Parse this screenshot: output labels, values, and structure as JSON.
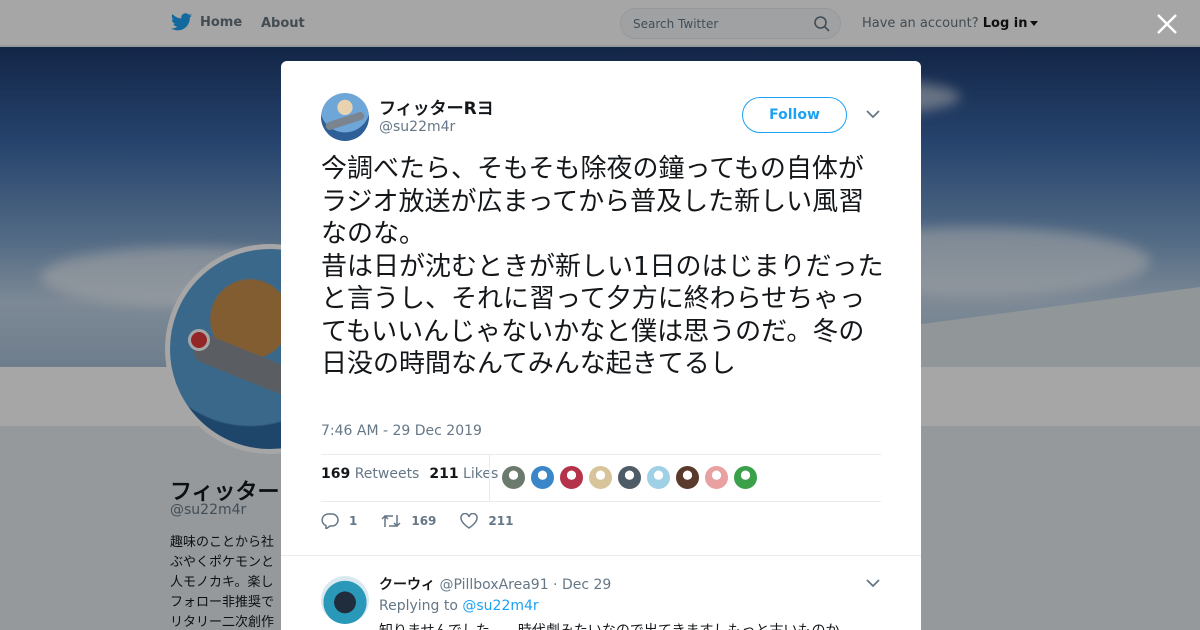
{
  "nav": {
    "home_label": "Home",
    "about_label": "About",
    "search_placeholder": "Search Twitter",
    "account_prompt": "Have an account?",
    "login_label": "Log in"
  },
  "profile_bg": {
    "name": "フィッターR",
    "handle": "@su22m4r",
    "bio_lines": [
      "趣味のことから社",
      "ぶやくポケモンと",
      "人モノカキ。楽し",
      "フォロー非推奨で",
      "リタリー二次創作"
    ]
  },
  "tweet": {
    "author_name": "フィッターRヨ",
    "author_handle": "@su22m4r",
    "follow_label": "Follow",
    "text": "今調べたら、そもそも除夜の鐘ってもの自体がラジオ放送が広まってから普及した新しい風習なのな。\n昔は日が沈むときが新しい1日のはじまりだったと言うし、それに習って夕方に終わらせちゃってもいいんじゃないかなと僕は思うのだ。冬の日没の時間なんてみんな起きてるし",
    "timestamp": "7:46 AM - 29 Dec 2019",
    "retweets_count": "169",
    "retweets_label": "Retweets",
    "likes_count": "211",
    "likes_label": "Likes",
    "reply_count": "1",
    "retweet_action_count": "169",
    "like_action_count": "211",
    "liker_colors": [
      "#6b7a6d",
      "#3b86c9",
      "#b4324a",
      "#d8c49a",
      "#4d5c66",
      "#9fd1e6",
      "#5a3a2a",
      "#e8a0a0",
      "#3aa04a"
    ]
  },
  "reply": {
    "name": "クーウィ",
    "handle": "@PillboxArea91",
    "date": "Dec 29",
    "replying_prefix": "Replying to",
    "replying_to": "@su22m4r",
    "text": "知りませんでした……時代劇みたいなので出てきますしもっと古いものか"
  }
}
